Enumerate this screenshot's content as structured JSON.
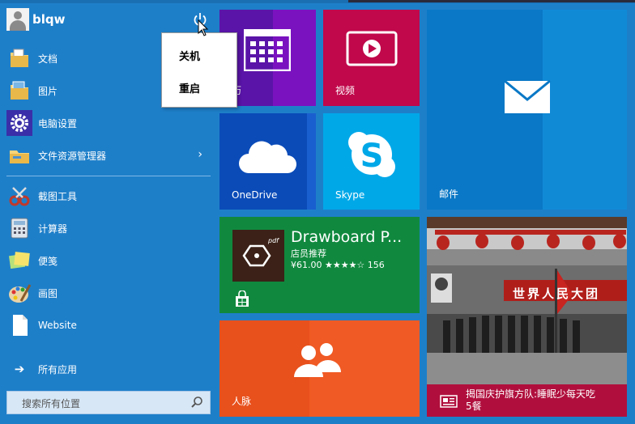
{
  "user": {
    "name": "blqw"
  },
  "left_items": [
    {
      "label": "文档",
      "icon": "documents-folder-icon"
    },
    {
      "label": "图片",
      "icon": "pictures-folder-icon"
    },
    {
      "label": "电脑设置",
      "icon": "settings-gear-icon"
    },
    {
      "label": "文件资源管理器",
      "icon": "file-explorer-icon",
      "has_submenu": true
    },
    {
      "label": "截图工具",
      "icon": "snipping-tool-icon"
    },
    {
      "label": "计算器",
      "icon": "calculator-icon"
    },
    {
      "label": "便笺",
      "icon": "sticky-notes-icon"
    },
    {
      "label": "画图",
      "icon": "paint-icon"
    },
    {
      "label": "Website",
      "icon": "document-page-icon"
    }
  ],
  "all_apps": {
    "label": "所有应用"
  },
  "search": {
    "placeholder": "搜索所有位置"
  },
  "power_menu": {
    "items": [
      "关机",
      "重启"
    ]
  },
  "tiles": {
    "calendar": {
      "label": "日历",
      "visible_label": "历",
      "color": "#6a1fb3"
    },
    "video": {
      "label": "视频",
      "color": "#c0084a"
    },
    "mail": {
      "label": "邮件",
      "color": "#0a78c6"
    },
    "onedrive": {
      "label": "OneDrive",
      "color": "#0a4bb8"
    },
    "skype": {
      "label": "Skype",
      "color": "#00a8e8"
    },
    "store": {
      "title": "Drawboard P...",
      "subtitle": "店员推荐",
      "price_rating": "¥61.00 ★★★★☆ 156",
      "logo_text": "pdf",
      "color": "#10893e"
    },
    "people": {
      "label": "人脉",
      "color": "#f05a24"
    },
    "news": {
      "headline": "揭国庆护旗方队:睡眠少每天吃",
      "headline2": "5餐",
      "banner_text": "世界人民大团"
    }
  },
  "colors": {
    "accent": "#1e7fc9",
    "popup_bg": "#ffffff"
  }
}
